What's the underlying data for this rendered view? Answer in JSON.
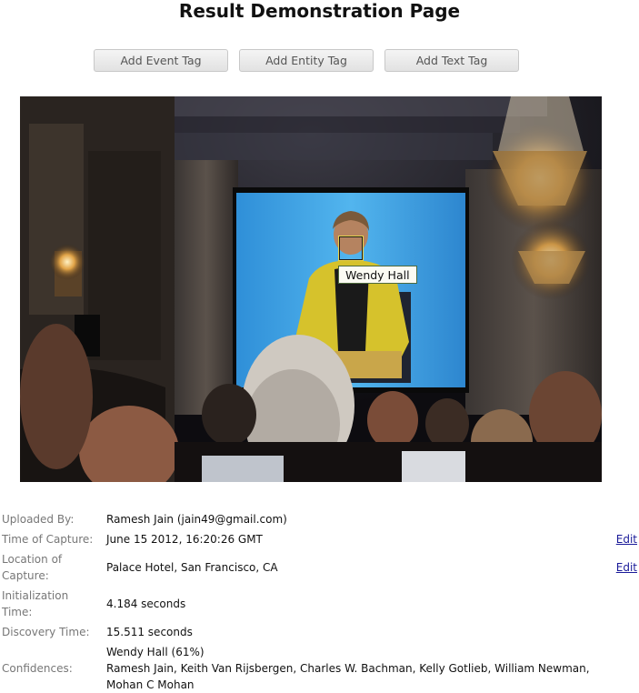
{
  "page": {
    "title": "Result Demonstration Page"
  },
  "toolbar": {
    "add_event_tag": "Add Event Tag",
    "add_entity_tag": "Add Entity Tag",
    "add_text_tag": "Add Text Tag"
  },
  "photo": {
    "face_tag_label": "Wendy Hall"
  },
  "details": {
    "uploaded_by_label": "Uploaded By:",
    "uploaded_by_value": "Ramesh Jain (jain49@gmail.com)",
    "time_label": "Time of Capture:",
    "time_value": "June 15 2012, 16:20:26 GMT",
    "location_label_1": "Location of",
    "location_label_2": "Capture:",
    "location_value": "Palace Hotel, San Francisco, CA",
    "init_label_1": "Initialization",
    "init_label_2": "Time:",
    "init_value": "4.184 seconds",
    "discovery_label": "Discovery Time:",
    "discovery_value": "15.511 seconds",
    "confidences_label": "Confidences:",
    "confidence_primary": "Wendy Hall (61%)",
    "confidence_others_1": "Ramesh Jain, Keith Van Rijsbergen, Charles W. Bachman, Kelly Gotlieb, William Newman,",
    "confidence_others_2": "Mohan C Mohan",
    "edit_label": "Edit"
  }
}
